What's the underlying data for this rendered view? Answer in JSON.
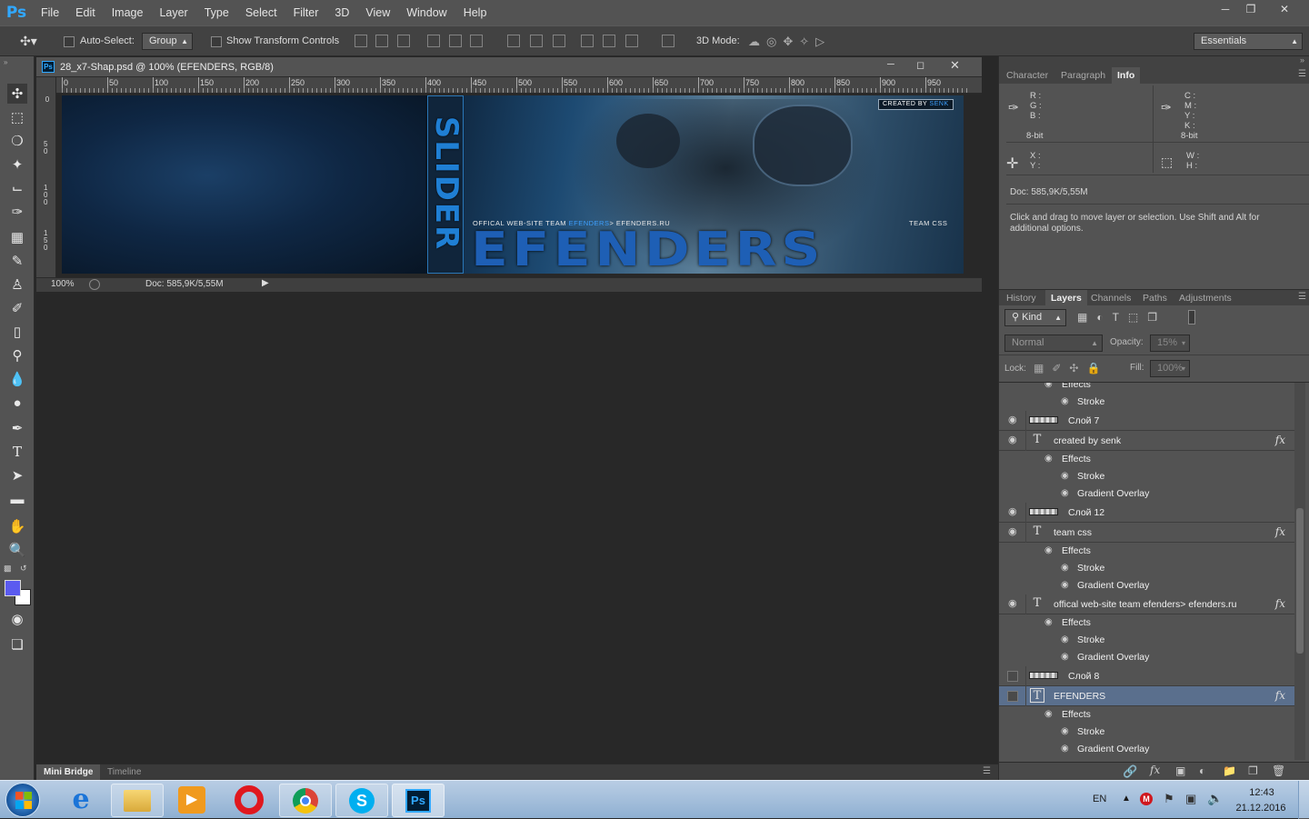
{
  "app": {
    "logo": "Ps"
  },
  "menu": [
    "File",
    "Edit",
    "Image",
    "Layer",
    "Type",
    "Select",
    "Filter",
    "3D",
    "View",
    "Window",
    "Help"
  ],
  "options": {
    "auto_select_label": "Auto-Select:",
    "auto_select_value": "Group",
    "transform_label": "Show Transform Controls",
    "mode3d_label": "3D Mode:",
    "workspace": "Essentials"
  },
  "document": {
    "title": "28_x7-Shap.psd @ 100% (EFENDERS, RGB/8)",
    "zoom": "100%",
    "doc_size": "Doc: 585,9K/5,55M",
    "ruler_ticks": [
      "0",
      "50",
      "100",
      "150",
      "200",
      "250",
      "300",
      "350",
      "400",
      "450",
      "500",
      "550",
      "600",
      "650",
      "700",
      "750",
      "800",
      "850",
      "900",
      "950"
    ],
    "vruler_ticks": [
      "0",
      "5 0",
      "1 0 0",
      "1 5 0"
    ],
    "banner": {
      "slider_text": "SLIDER",
      "created_by_label": "CREATED BY",
      "created_by_name": "SENK",
      "official_prefix": "OFFICAL WEB-SITE TEAM",
      "official_team": "EFENDERS",
      "official_suffix": "> EFENDERS.RU",
      "team_text": "TEAM CSS",
      "big_title": "EFENDERS"
    }
  },
  "info_panel": {
    "tabs": [
      "Character",
      "Paragraph",
      "Info"
    ],
    "rgb_labels": "R :\nG :\nB :",
    "cmyk_labels": "C :\nM :\nY :\nK :",
    "bit_left": "8-bit",
    "bit_right": "8-bit",
    "xy_labels": "X :\nY :",
    "wh_labels": "W :\nH :",
    "doc_size": "Doc: 585,9K/5,55M",
    "hint": "Click and drag to move layer or selection.  Use Shift and Alt for additional options."
  },
  "layers_panel": {
    "tabs": [
      "History",
      "Layers",
      "Channels",
      "Paths",
      "Adjustments"
    ],
    "kind_label": "Kind",
    "blend_mode": "Normal",
    "opacity_label": "Opacity:",
    "opacity_value": "15%",
    "lock_label": "Lock:",
    "fill_label": "Fill:",
    "fill_value": "100%",
    "rows": [
      {
        "type": "effects",
        "label": "Effects"
      },
      {
        "type": "effect",
        "label": "Stroke"
      },
      {
        "type": "image",
        "label": "Слой 7"
      },
      {
        "type": "text",
        "label": "created by senk"
      },
      {
        "type": "effects",
        "label": "Effects"
      },
      {
        "type": "effect",
        "label": "Stroke"
      },
      {
        "type": "effect",
        "label": "Gradient Overlay"
      },
      {
        "type": "image",
        "label": "Слой 12"
      },
      {
        "type": "text",
        "label": "team css"
      },
      {
        "type": "effects",
        "label": "Effects"
      },
      {
        "type": "effect",
        "label": "Stroke"
      },
      {
        "type": "effect",
        "label": "Gradient Overlay"
      },
      {
        "type": "text",
        "label": "offical web-site team efenders> efenders.ru"
      },
      {
        "type": "effects",
        "label": "Effects"
      },
      {
        "type": "effect",
        "label": "Stroke"
      },
      {
        "type": "effect",
        "label": "Gradient Overlay"
      },
      {
        "type": "image",
        "label": "Слой 8"
      },
      {
        "type": "text",
        "label": "EFENDERS"
      },
      {
        "type": "effects",
        "label": "Effects"
      },
      {
        "type": "effect",
        "label": "Stroke"
      },
      {
        "type": "effect",
        "label": "Gradient Overlay"
      }
    ]
  },
  "bottom_tabs": [
    "Mini Bridge",
    "Timeline"
  ],
  "taskbar": {
    "lang": "EN",
    "time": "12:43",
    "date": "21.12.2016"
  },
  "colors": {
    "accent": "#31a8ff",
    "foreground": "#5b5bf0",
    "selected_layer": "#5a6f8d"
  }
}
